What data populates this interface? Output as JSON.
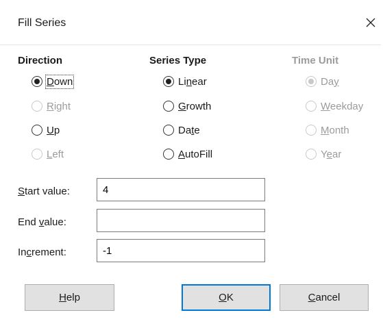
{
  "window": {
    "title": "Fill Series"
  },
  "direction": {
    "heading": "Direction",
    "options": [
      {
        "label": "Down",
        "underline": "D",
        "rest": "own",
        "selected": true,
        "enabled": true
      },
      {
        "label": "Right",
        "underline": "R",
        "rest": "ight",
        "selected": false,
        "enabled": false
      },
      {
        "label": "Up",
        "underline": "U",
        "rest": "p",
        "selected": false,
        "enabled": true
      },
      {
        "label": "Left",
        "underline": "L",
        "rest": "eft",
        "selected": false,
        "enabled": false
      }
    ]
  },
  "series_type": {
    "heading": "Series Type",
    "options": [
      {
        "label": "Linear",
        "pre": "Li",
        "underline": "n",
        "rest": "ear",
        "selected": true,
        "enabled": true
      },
      {
        "label": "Growth",
        "pre": "",
        "underline": "G",
        "rest": "rowth",
        "selected": false,
        "enabled": true
      },
      {
        "label": "Date",
        "pre": "Da",
        "underline": "t",
        "rest": "e",
        "selected": false,
        "enabled": true
      },
      {
        "label": "AutoFill",
        "pre": "",
        "underline": "A",
        "rest": "utoFill",
        "selected": false,
        "enabled": true
      }
    ]
  },
  "time_unit": {
    "heading": "Time Unit",
    "options": [
      {
        "label": "Day",
        "pre": "Da",
        "underline": "y",
        "rest": "",
        "selected": true,
        "enabled": false
      },
      {
        "label": "Weekday",
        "pre": "",
        "underline": "W",
        "rest": "eekday",
        "selected": false,
        "enabled": false
      },
      {
        "label": "Month",
        "pre": "",
        "underline": "M",
        "rest": "onth",
        "selected": false,
        "enabled": false
      },
      {
        "label": "Year",
        "pre": "Y",
        "underline": "e",
        "rest": "ar",
        "selected": false,
        "enabled": false
      }
    ]
  },
  "fields": {
    "start": {
      "pre": "",
      "underline": "S",
      "rest": "tart value:",
      "value": "4"
    },
    "end": {
      "pre": "End ",
      "underline": "v",
      "rest": "alue:",
      "value": ""
    },
    "increment": {
      "pre": "In",
      "underline": "c",
      "rest": "rement:",
      "value": "-1"
    }
  },
  "buttons": {
    "help": {
      "underline": "H",
      "rest": "elp"
    },
    "ok": {
      "underline": "O",
      "rest": "K"
    },
    "cancel": {
      "underline": "C",
      "rest": "ancel"
    }
  },
  "colors": {
    "accent": "#0078d7",
    "disabled_text": "#9b9b9b",
    "button_bg": "#e1e1e1"
  }
}
